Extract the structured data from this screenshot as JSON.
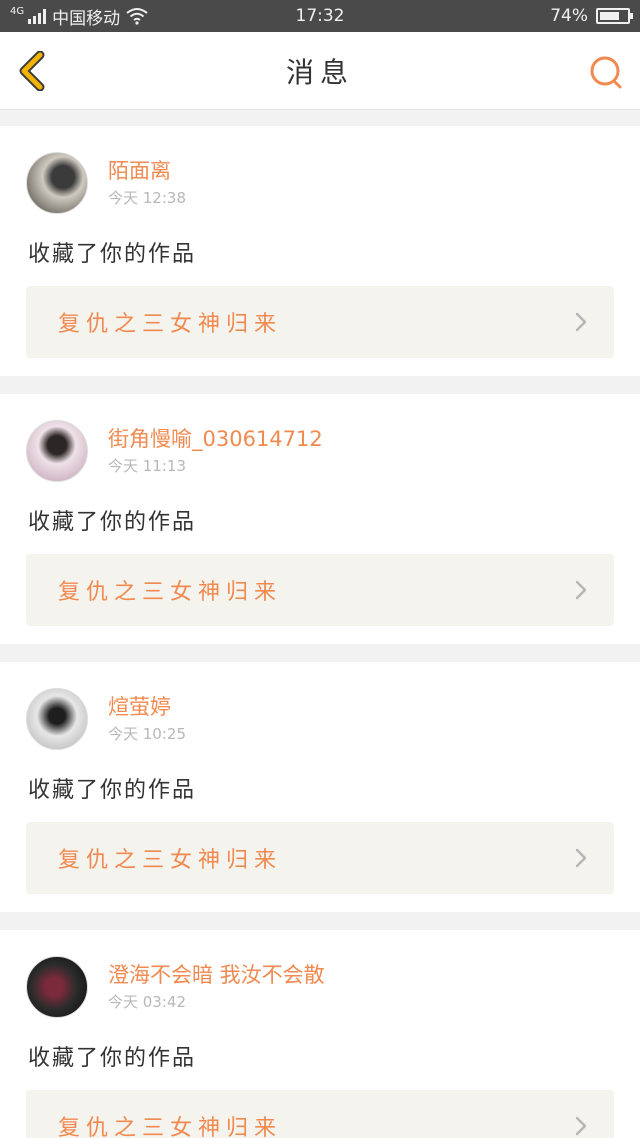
{
  "statusbar": {
    "network": "4G",
    "carrier": "中国移动",
    "time": "17:32",
    "battery": "74%",
    "battery_level": 0.74
  },
  "header": {
    "title": "消息",
    "back_icon": "chevron-left-icon",
    "search_icon": "search-icon"
  },
  "colors": {
    "accent": "#f08a50",
    "back_arrow": "#f2b200"
  },
  "notifications": [
    {
      "username": "陌面离",
      "time": "今天 12:38",
      "action": "收藏了你的作品",
      "work": "复仇之三女神归来"
    },
    {
      "username": "街角慢喻_030614712",
      "time": "今天 11:13",
      "action": "收藏了你的作品",
      "work": "复仇之三女神归来"
    },
    {
      "username": "煊萤婷",
      "time": "今天 10:25",
      "action": "收藏了你的作品",
      "work": "复仇之三女神归来"
    },
    {
      "username": "澄海不会暗 我汝不会散",
      "time": "今天 03:42",
      "action": "收藏了你的作品",
      "work": "复仇之三女神归来"
    }
  ]
}
